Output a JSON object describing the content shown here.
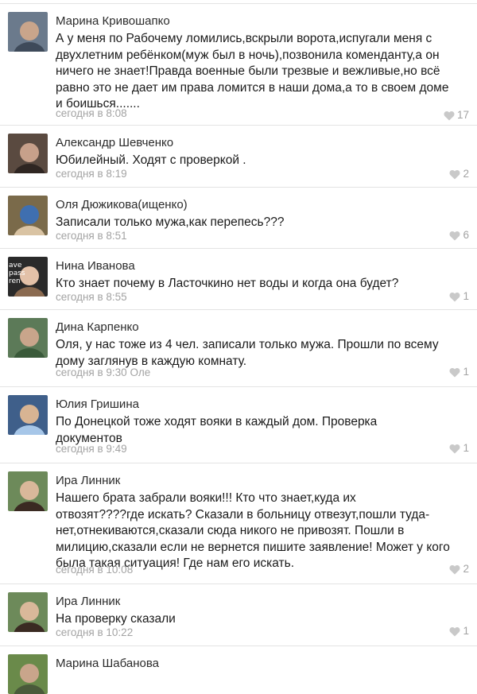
{
  "comments": [
    {
      "author": "Марина Кривошапко",
      "lines": [
        "А у меня по Рабочему ломились,вскрыли ворота,испугали меня с",
        "двухлетним ребёнком(муж был в ночь),позвонила коменданту,а он",
        "ничего не знает!Правда военные были трезвые и вежливые,но всё",
        "равно это не дает им права ломится в наши дома,а то в своем доме",
        "и боишься......."
      ],
      "time": "сегодня в 8:08",
      "likes": "17",
      "avatar_colors": [
        "#6b7a8c",
        "#c9a58b",
        "#3e4a5a"
      ]
    },
    {
      "author": "Александр Шевченко",
      "lines": [
        "Юбилейный. Ходят с проверкой ."
      ],
      "time": "сегодня в 8:19",
      "likes": "2",
      "avatar_colors": [
        "#5a4a40",
        "#c7a08a",
        "#2f2622"
      ]
    },
    {
      "author": "Оля Дюжикова(ищенко)",
      "lines": [
        "Записали только мужа,как перепесь???"
      ],
      "time": "сегодня в 8:51",
      "likes": "6",
      "avatar_colors": [
        "#7a6a4a",
        "#3f6fb0",
        "#d9c3a3"
      ]
    },
    {
      "author": "Нина Иванова",
      "lines": [
        "Кто знает почему в Ласточкино нет воды и когда она будет?"
      ],
      "time": "сегодня в 8:55",
      "likes": "1",
      "avatar_colors": [
        "#2a2a2a",
        "#e3c1a8",
        "#8a6a50"
      ],
      "avatar_text": [
        "ave",
        "pass",
        "ren"
      ]
    },
    {
      "author": "Дина Карпенко",
      "lines": [
        "Оля, у нас тоже из 4 чел. записали только мужа. Прошли по всему",
        "дому заглянув в каждую комнату."
      ],
      "time": "сегодня в 9:30",
      "time_suffix": "Оле",
      "likes": "1",
      "avatar_colors": [
        "#5c7a58",
        "#c9a58b",
        "#3a5a3a"
      ]
    },
    {
      "author": "Юлия Гришина",
      "lines": [
        "По Донецкой тоже ходят вояки в каждый дом. Проверка",
        "документов"
      ],
      "time": "сегодня в 9:49",
      "likes": "1",
      "avatar_colors": [
        "#3f5f8a",
        "#d8b493",
        "#a6c6e8"
      ]
    },
    {
      "author": "Ира Линник",
      "lines": [
        "Нашего брата забрали вояки!!! Кто что знает,куда их",
        "отвозят????где искать? Сказали в больницу отвезут,пошли туда-",
        "нет,отнекиваются,сказали сюда никого не привозят. Пошли в",
        "милицию,сказали если не вернется пишите заявление! Может у кого",
        "была такая ситуация! Где нам его искать."
      ],
      "time": "сегодня в 10:08",
      "likes": "2",
      "avatar_colors": [
        "#6d8a5a",
        "#d9b89a",
        "#3a2a22"
      ]
    },
    {
      "author": "Ира Линник",
      "lines": [
        "На проверку сказали"
      ],
      "time": "сегодня в 10:22",
      "likes": "1",
      "avatar_colors": [
        "#6d8a5a",
        "#d9b89a",
        "#3a2a22"
      ]
    },
    {
      "author": "Марина Шабанова",
      "lines": [],
      "time": "",
      "likes": "",
      "avatar_colors": [
        "#6a8a4a",
        "#c9a58b",
        "#4a5a3a"
      ]
    }
  ],
  "colors": {
    "separator": "#e3e3e3",
    "meta_text": "#a3a3a3",
    "heart": "#c9c9c9"
  },
  "icons": {
    "like": "heart-icon"
  }
}
